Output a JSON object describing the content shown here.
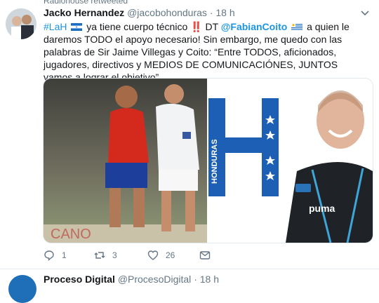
{
  "context": {
    "retweet_label": "Radiohouse retweeted"
  },
  "tweet": {
    "author_name": "Jacko Hernandez",
    "author_handle": "@jacobohonduras",
    "separator": "·",
    "time": "18 h",
    "text": {
      "hashtag": "#LaH",
      "part1": " ya tiene cuerpo técnico ",
      "exclaim": "‼️",
      "part2": " DT ",
      "mention": "@FabianCoito",
      "part3": " a quien le daremos TODO el apoyo necesario! Sin embargo, me quedo con las palabras de Sir Jaime Villegas y Coito: “Entre TODOS, aficionados, jugadores, directivos y MEDIOS DE COMUNICACIÓNES, JUNTOS vamos a lograr el objetivo”"
    },
    "media": {
      "left_alt": "photo of two soccer players in a match",
      "right_letter": "H",
      "right_banner": "HONDURAS",
      "right_alt": "photo of smiling coach"
    },
    "actions": {
      "reply_count": "1",
      "retweet_count": "3",
      "like_count": "26",
      "reply_icon": "reply-icon",
      "retweet_icon": "retweet-icon",
      "like_icon": "heart-icon",
      "dm_icon": "mail-icon"
    }
  },
  "next_tweet": {
    "author_name": "Proceso Digital",
    "author_handle": "@ProcesoDigital",
    "separator": "·",
    "time": "18 h"
  },
  "colors": {
    "link": "#1b95e0",
    "muted": "#657786",
    "text": "#14171a"
  }
}
